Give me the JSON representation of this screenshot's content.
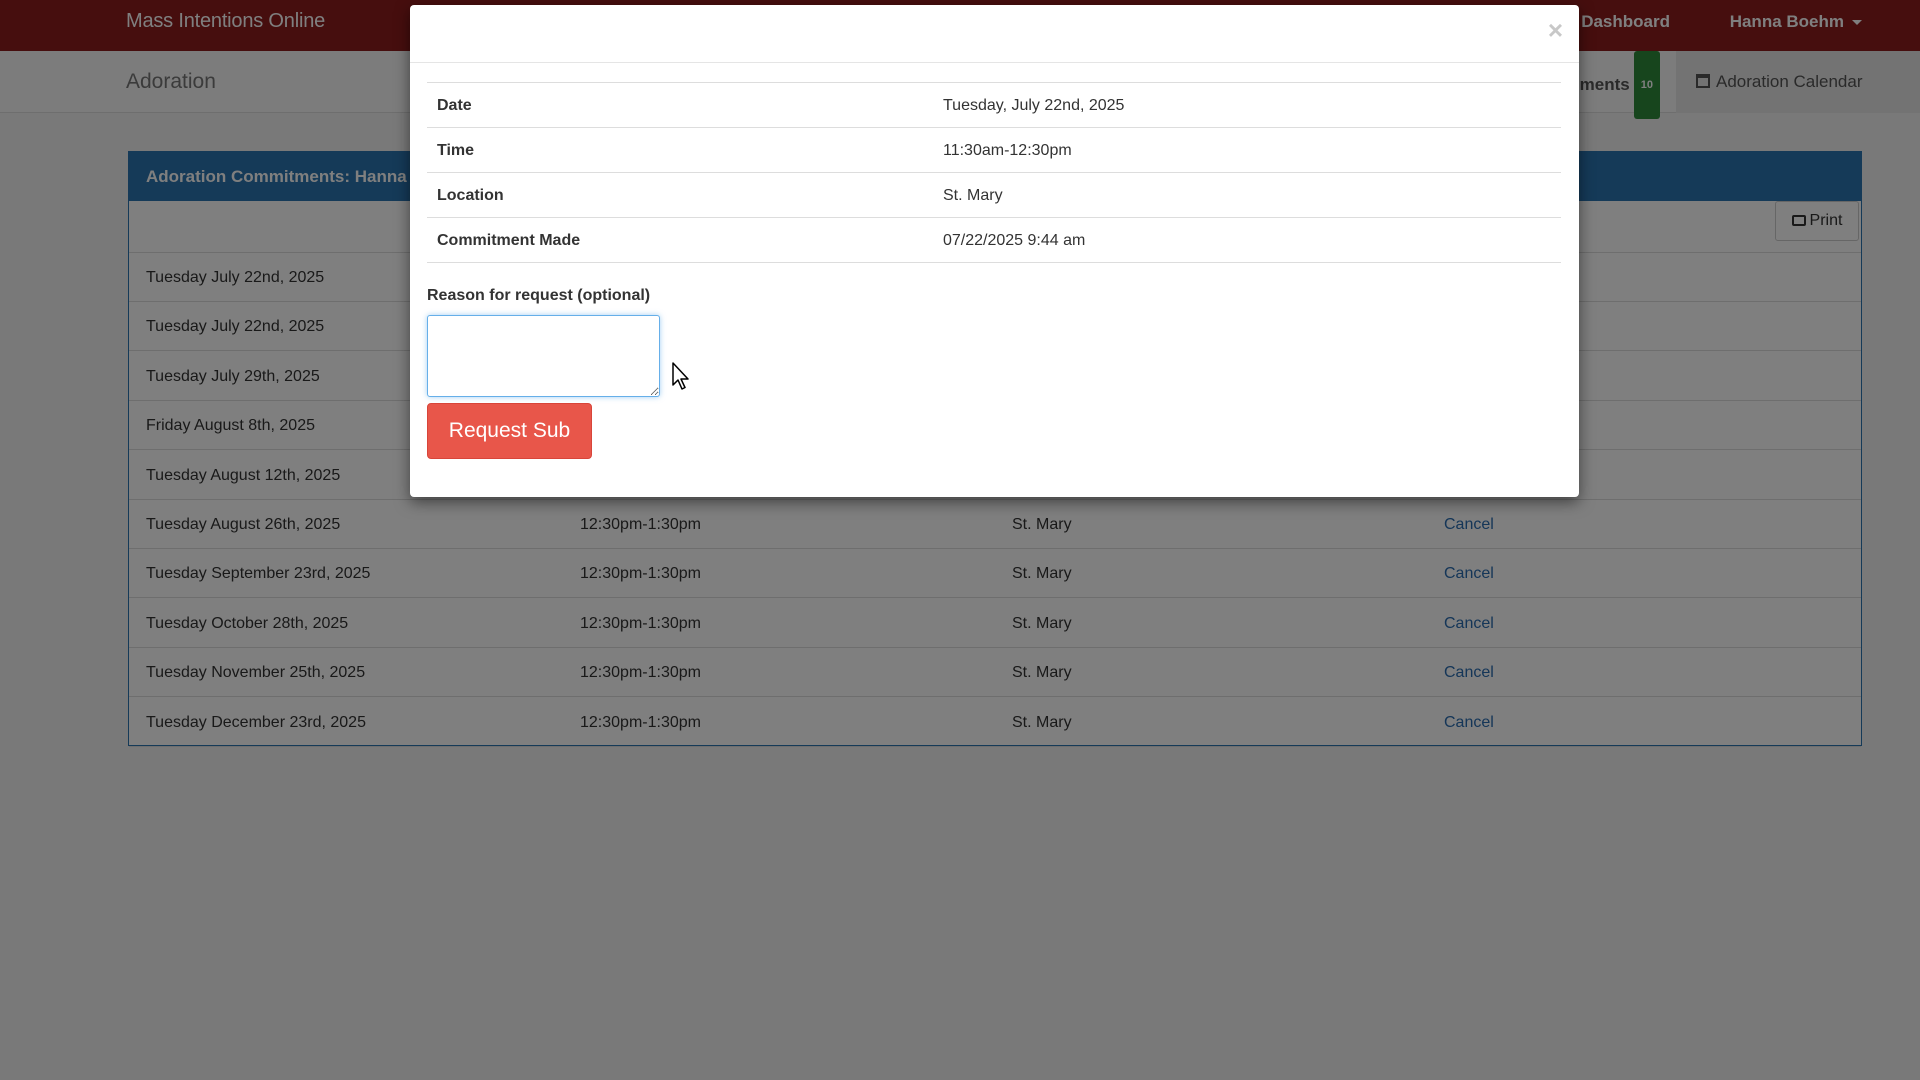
{
  "navbar": {
    "brand": "Mass Intentions Online",
    "dashboard_label": "n Dashboard",
    "user_name": "Hanna Boehm"
  },
  "subnav": {
    "title": "Adoration",
    "commitments_label": "ments",
    "commitments_count": "10",
    "calendar_label": "Adoration Calendar"
  },
  "panel": {
    "heading": "Adoration Commitments: Hanna",
    "print_label": "Print",
    "rows": [
      {
        "date": "Tuesday July 22nd, 2025",
        "time": "",
        "location": "",
        "action": ""
      },
      {
        "date": "Tuesday July 22nd, 2025",
        "time": "",
        "location": "",
        "action": ""
      },
      {
        "date": "Tuesday July 29th, 2025",
        "time": "",
        "location": "",
        "action": ""
      },
      {
        "date": "Friday August 8th, 2025",
        "time": "",
        "location": "",
        "action": ""
      },
      {
        "date": "Tuesday August 12th, 2025",
        "time": "",
        "location": "",
        "action": ""
      },
      {
        "date": "Tuesday August 26th, 2025",
        "time": "12:30pm-1:30pm",
        "location": "St. Mary",
        "action": "Cancel"
      },
      {
        "date": "Tuesday September 23rd, 2025",
        "time": "12:30pm-1:30pm",
        "location": "St. Mary",
        "action": "Cancel"
      },
      {
        "date": "Tuesday October 28th, 2025",
        "time": "12:30pm-1:30pm",
        "location": "St. Mary",
        "action": "Cancel"
      },
      {
        "date": "Tuesday November 25th, 2025",
        "time": "12:30pm-1:30pm",
        "location": "St. Mary",
        "action": "Cancel"
      },
      {
        "date": "Tuesday December 23rd, 2025",
        "time": "12:30pm-1:30pm",
        "location": "St. Mary",
        "action": "Cancel"
      }
    ]
  },
  "modal": {
    "close_glyph": "×",
    "details": [
      {
        "label": "Date",
        "value": "Tuesday, July 22nd, 2025"
      },
      {
        "label": "Time",
        "value": "11:30am-12:30pm"
      },
      {
        "label": "Location",
        "value": "St. Mary"
      },
      {
        "label": "Commitment Made",
        "value": "07/22/2025 9:44 am"
      }
    ],
    "reason_label": "Reason for request (optional)",
    "reason_value": "",
    "submit_label": "Request Sub"
  },
  "colors": {
    "navbar": "#8c1c1c",
    "panel_heading": "#2a74b0",
    "request_button": "#e8564a",
    "badge": "#2e8b3a"
  },
  "icons": [
    "print-icon",
    "calendar-icon",
    "close-icon",
    "caret-down-icon"
  ]
}
